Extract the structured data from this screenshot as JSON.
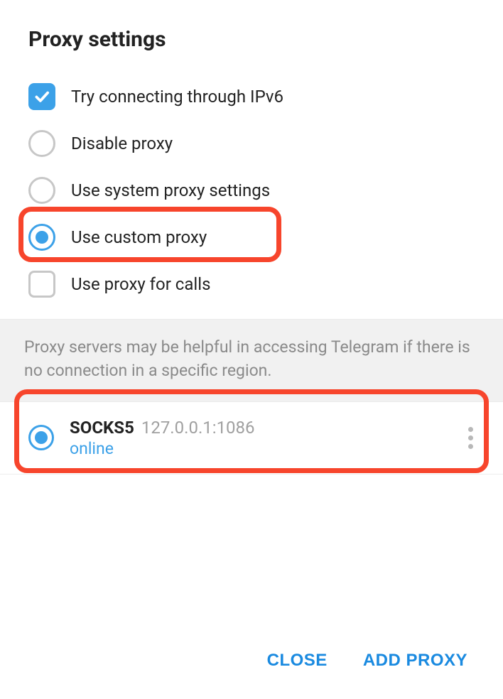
{
  "title": "Proxy settings",
  "options": {
    "ipv6": {
      "label": "Try connecting through IPv6",
      "checked": true
    },
    "disable": {
      "label": "Disable proxy",
      "selected": false
    },
    "system": {
      "label": "Use system proxy settings",
      "selected": false
    },
    "custom": {
      "label": "Use custom proxy",
      "selected": true
    },
    "calls": {
      "label": "Use proxy for calls",
      "checked": false
    }
  },
  "info_text": "Proxy servers may be helpful in accessing Telegram if there is no connection in a specific region.",
  "proxies": [
    {
      "type": "SOCKS5",
      "address": "127.0.0.1:1086",
      "status": "online",
      "selected": true
    }
  ],
  "footer": {
    "close": "CLOSE",
    "add": "ADD PROXY"
  }
}
